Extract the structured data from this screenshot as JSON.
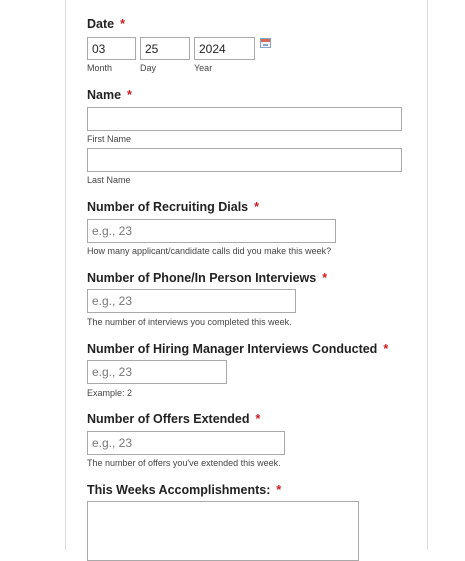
{
  "form": {
    "date": {
      "label": "Date",
      "required_mark": "*",
      "month_value": "03",
      "day_value": "25",
      "year_value": "2024",
      "month_label": "Month",
      "day_label": "Day",
      "year_label": "Year"
    },
    "name": {
      "label": "Name",
      "required_mark": "*",
      "first_label": "First Name",
      "last_label": "Last Name"
    },
    "recruiting_dials": {
      "label": "Number of Recruiting Dials",
      "required_mark": "*",
      "placeholder": "e.g., 23",
      "help": "How many applicant/candidate calls did you make this week?"
    },
    "interviews": {
      "label": "Number of Phone/In Person Interviews",
      "required_mark": "*",
      "placeholder": "e.g., 23",
      "help": "The number of interviews you completed this week."
    },
    "hiring_manager": {
      "label": "Number of Hiring Manager Interviews Conducted",
      "required_mark": "*",
      "placeholder": "e.g., 23",
      "help": "Example: 2"
    },
    "offers": {
      "label": "Number of Offers Extended",
      "required_mark": "*",
      "placeholder": "e.g., 23",
      "help": "The number of offers you've extended this week."
    },
    "accomplishments": {
      "label": "This Weeks Accomplishments:",
      "required_mark": "*"
    }
  },
  "icons": {
    "calendar": "calendar-icon"
  }
}
